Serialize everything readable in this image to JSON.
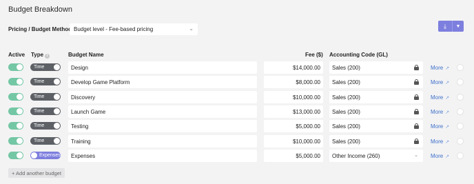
{
  "title": "Budget Breakdown",
  "method": {
    "label": "Pricing / Budget Method",
    "required_mark": "*",
    "value": "Budget level - Fee-based pricing"
  },
  "download_button": {
    "icon": "download-icon",
    "dropdown_icon": "chevron-down-icon"
  },
  "columns": {
    "active": "Active",
    "type": "Type",
    "budget_name": "Budget Name",
    "fee": "Fee ($)",
    "gl": "Accounting Code (GL)"
  },
  "rows": [
    {
      "active": true,
      "type": "Time",
      "name": "Design",
      "fee": "$14,000.00",
      "gl": "Sales (200)",
      "locked": true,
      "more": "More"
    },
    {
      "active": true,
      "type": "Time",
      "name": "Develop Game Platform",
      "fee": "$8,000.00",
      "gl": "Sales (200)",
      "locked": true,
      "more": "More"
    },
    {
      "active": true,
      "type": "Time",
      "name": "Discovery",
      "fee": "$10,000.00",
      "gl": "Sales (200)",
      "locked": true,
      "more": "More"
    },
    {
      "active": true,
      "type": "Time",
      "name": "Launch Game",
      "fee": "$13,000.00",
      "gl": "Sales (200)",
      "locked": true,
      "more": "More"
    },
    {
      "active": true,
      "type": "Time",
      "name": "Testing",
      "fee": "$5,000.00",
      "gl": "Sales (200)",
      "locked": true,
      "more": "More"
    },
    {
      "active": true,
      "type": "Time",
      "name": "Training",
      "fee": "$10,000.00",
      "gl": "Sales (200)",
      "locked": true,
      "more": "More"
    },
    {
      "active": true,
      "type": "Expenses",
      "name": "Expenses",
      "fee": "$5,000.00",
      "gl": "Other Income (260)",
      "locked": false,
      "more": "More"
    }
  ],
  "add_button": "+ Add another budget",
  "colors": {
    "accent": "#7d7fde",
    "active_toggle": "#74c7a4",
    "time_toggle": "#5d6166",
    "link": "#3d6fc9"
  }
}
